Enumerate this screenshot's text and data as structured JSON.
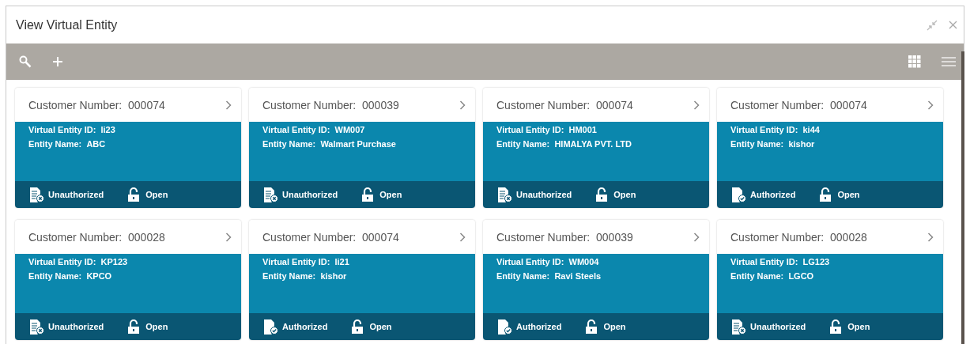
{
  "window": {
    "title": "View Virtual Entity"
  },
  "view_buttons": [
    {
      "kind": "grid",
      "selected": true
    },
    {
      "kind": "list",
      "selected": false
    }
  ],
  "cards": [
    {
      "customer_label": "Customer Number:",
      "customer_number": "000074",
      "id_label": "Virtual Entity ID:",
      "entity_id": "li23",
      "name_label": "Entity Name:",
      "entity_name": "ABC",
      "status": {
        "label": "Unauthorized",
        "authorized": false
      },
      "lock": {
        "label": "Open",
        "locked": false
      }
    },
    {
      "customer_label": "Customer Number:",
      "customer_number": "000039",
      "id_label": "Virtual Entity ID:",
      "entity_id": "WM007",
      "name_label": "Entity Name:",
      "entity_name": "Walmart Purchase",
      "status": {
        "label": "Unauthorized",
        "authorized": false
      },
      "lock": {
        "label": "Open",
        "locked": false
      }
    },
    {
      "customer_label": "Customer Number:",
      "customer_number": "000074",
      "id_label": "Virtual Entity ID:",
      "entity_id": "HM001",
      "name_label": "Entity Name:",
      "entity_name": "HIMALYA PVT. LTD",
      "status": {
        "label": "Unauthorized",
        "authorized": false
      },
      "lock": {
        "label": "Open",
        "locked": false
      }
    },
    {
      "customer_label": "Customer Number:",
      "customer_number": "000074",
      "id_label": "Virtual Entity ID:",
      "entity_id": "ki44",
      "name_label": "Entity Name:",
      "entity_name": "kishor",
      "status": {
        "label": "Authorized",
        "authorized": true
      },
      "lock": {
        "label": "Open",
        "locked": false
      }
    },
    {
      "customer_label": "Customer Number:",
      "customer_number": "000028",
      "id_label": "Virtual Entity ID:",
      "entity_id": "KP123",
      "name_label": "Entity Name:",
      "entity_name": "KPCO",
      "status": {
        "label": "Unauthorized",
        "authorized": false
      },
      "lock": {
        "label": "Open",
        "locked": false
      }
    },
    {
      "customer_label": "Customer Number:",
      "customer_number": "000074",
      "id_label": "Virtual Entity ID:",
      "entity_id": "li21",
      "name_label": "Entity Name:",
      "entity_name": "kishor",
      "status": {
        "label": "Authorized",
        "authorized": true
      },
      "lock": {
        "label": "Open",
        "locked": false
      }
    },
    {
      "customer_label": "Customer Number:",
      "customer_number": "000039",
      "id_label": "Virtual Entity ID:",
      "entity_id": "WM004",
      "name_label": "Entity Name:",
      "entity_name": "Ravi Steels",
      "status": {
        "label": "Authorized",
        "authorized": true
      },
      "lock": {
        "label": "Open",
        "locked": false
      }
    },
    {
      "customer_label": "Customer Number:",
      "customer_number": "000028",
      "id_label": "Virtual Entity ID:",
      "entity_id": "LG123",
      "name_label": "Entity Name:",
      "entity_name": "LGCO",
      "status": {
        "label": "Unauthorized",
        "authorized": false
      },
      "lock": {
        "label": "Open",
        "locked": false
      }
    }
  ]
}
